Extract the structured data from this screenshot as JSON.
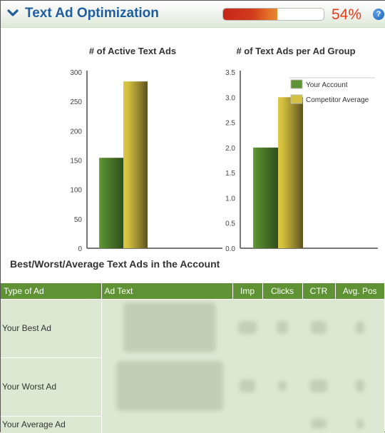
{
  "header": {
    "title": "Text Ad Optimization",
    "progress_percent": 54,
    "progress_label": "54%",
    "help_glyph": "?",
    "colors": {
      "title": "#1f5e9e",
      "percent": "#e43b1c",
      "progress_fill": "#d23c1c"
    }
  },
  "chart_data": [
    {
      "type": "bar",
      "title": "# of Active Text Ads",
      "categories": [
        "Your Account",
        "Competitor Average"
      ],
      "values": [
        154,
        284
      ],
      "xlabel": "",
      "ylabel": "",
      "ylim": [
        0,
        300
      ],
      "yticks": [
        "0",
        "50",
        "100",
        "150",
        "200",
        "250",
        "300"
      ],
      "ytick_values": [
        0,
        50,
        100,
        150,
        200,
        250,
        300
      ],
      "grid": false,
      "colors": [
        "#4f7d2a",
        "#c9b63a"
      ]
    },
    {
      "type": "bar",
      "title": "# of Text Ads per Ad Group",
      "categories": [
        "Your Account",
        "Competitor Average"
      ],
      "values": [
        2.0,
        3.0
      ],
      "xlabel": "",
      "ylabel": "",
      "ylim": [
        0,
        3.5
      ],
      "yticks": [
        "0.0",
        "0.5",
        "1.0",
        "1.5",
        "2.0",
        "2.5",
        "3.0",
        "3.5"
      ],
      "ytick_values": [
        0,
        0.5,
        1.0,
        1.5,
        2.0,
        2.5,
        3.0,
        3.5
      ],
      "grid": false,
      "legend": {
        "placement": "top-right",
        "entries": [
          "Your Account",
          "Competitor Average"
        ]
      },
      "colors": [
        "#4f7d2a",
        "#c9b63a"
      ]
    }
  ],
  "table_section": {
    "title": "Best/Worst/Average Text Ads in the Account",
    "columns": [
      "Type of Ad",
      "Ad Text",
      "Imp",
      "Clicks",
      "CTR",
      "Avg. Pos"
    ],
    "rows": [
      {
        "type": "Your Best Ad"
      },
      {
        "type": "Your Worst Ad"
      },
      {
        "type": "Your Average Ad"
      }
    ]
  }
}
